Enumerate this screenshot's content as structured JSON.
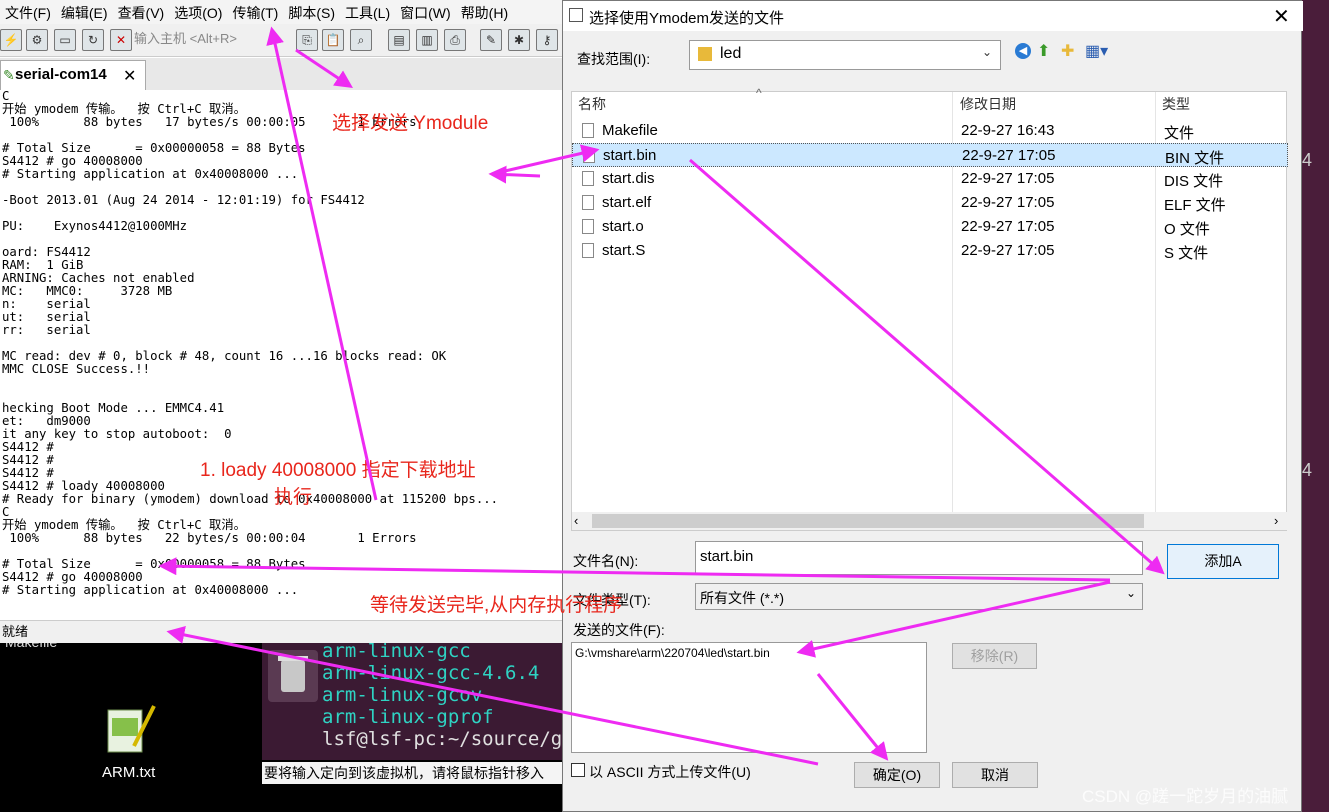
{
  "terminal": {
    "menu": [
      "文件(F)",
      "编辑(E)",
      "查看(V)",
      "选项(O)",
      "传输(T)",
      "脚本(S)",
      "工具(L)",
      "窗口(W)",
      "帮助(H)"
    ],
    "host_input_placeholder": "输入主机 <Alt+R>",
    "tab_label": "serial-com14",
    "lines": [
      "C",
      "开始 ymodem 传输。  按 Ctrl+C 取消。",
      " 100%      88 bytes   17 bytes/s 00:00:05       1 Errors",
      "",
      "# Total Size      = 0x00000058 = 88 Bytes",
      "S4412 # go 40008000",
      "# Starting application at 0x40008000 ...",
      "",
      "-Boot 2013.01 (Aug 24 2014 - 12:01:19) for FS4412",
      "",
      "PU:    Exynos4412@1000MHz",
      "",
      "oard: FS4412",
      "RAM:  1 GiB",
      "ARNING: Caches not enabled",
      "MC:   MMC0:     3728 MB",
      "n:    serial",
      "ut:   serial",
      "rr:   serial",
      "",
      "MC read: dev # 0, block # 48, count 16 ...16 blocks read: OK",
      "MMC CLOSE Success.!!",
      "",
      "",
      "hecking Boot Mode ... EMMC4.41",
      "et:   dm9000",
      "it any key to stop autoboot:  0",
      "S4412 #",
      "S4412 #",
      "S4412 #",
      "S4412 # loady 40008000",
      "# Ready for binary (ymodem) download to 0x40008000 at 115200 bps...",
      "C",
      "开始 ymodem 传输。  按 Ctrl+C 取消。",
      " 100%      88 bytes   22 bytes/s 00:00:04       1 Errors",
      "",
      "# Total Size      = 0x00000058 = 88 Bytes",
      "S4412 # go 40008000",
      "# Starting application at 0x40008000 ..."
    ],
    "status": "就绪"
  },
  "desktop": {
    "makefile_label": "Makefile",
    "arm_txt_label": "ARM.txt",
    "vm_lines": [
      "arm-linux-gcc",
      "arm-linux-gcc-4.6.4",
      "arm-linux-gcov",
      "arm-linux-gprof",
      "lsf@lsf-pc:~/source/gc"
    ],
    "vm_hint": "要将输入定向到该虚拟机，请将鼠标指针移入",
    "side_numbers": [
      "4",
      "4"
    ]
  },
  "dialog": {
    "title": "选择使用Ymodem发送的文件",
    "lookin_label": "查找范围(I):",
    "lookin_value": "led",
    "columns": {
      "name": "名称",
      "date": "修改日期",
      "type": "类型"
    },
    "files": [
      {
        "name": "Makefile",
        "date": "22-9-27 16:43",
        "type": "文件",
        "selected": false
      },
      {
        "name": "start.bin",
        "date": "22-9-27 17:05",
        "type": "BIN 文件",
        "selected": true
      },
      {
        "name": "start.dis",
        "date": "22-9-27 17:05",
        "type": "DIS 文件",
        "selected": false
      },
      {
        "name": "start.elf",
        "date": "22-9-27 17:05",
        "type": "ELF 文件",
        "selected": false
      },
      {
        "name": "start.o",
        "date": "22-9-27 17:05",
        "type": "O 文件",
        "selected": false
      },
      {
        "name": "start.S",
        "date": "22-9-27 17:05",
        "type": "S 文件",
        "selected": false
      }
    ],
    "filename_label": "文件名(N):",
    "filename_value": "start.bin",
    "add_button": "添加A",
    "filetype_label": "文件类型(T):",
    "filetype_value": "所有文件 (*.*)",
    "sent_files_label": "发送的文件(F):",
    "sent_files": [
      "G:\\vmshare\\arm\\220704\\led\\start.bin"
    ],
    "remove_button": "移除(R)",
    "ascii_checkbox_label": "以 ASCII 方式上传文件(U)",
    "ok_button": "确定(O)",
    "cancel_button": "取消"
  },
  "annotations": {
    "select_send": "选择发送 Ymodule",
    "step1_line1": "1.   loady 40008000 指定下载地址",
    "step1_line2": "执行",
    "wait": "等待发送完毕,从内存执行程序",
    "accent_color": "#e8261c",
    "arrow_color": "#ee2bf2"
  },
  "watermark": "CSDN @蹉一跎岁月的油腻"
}
